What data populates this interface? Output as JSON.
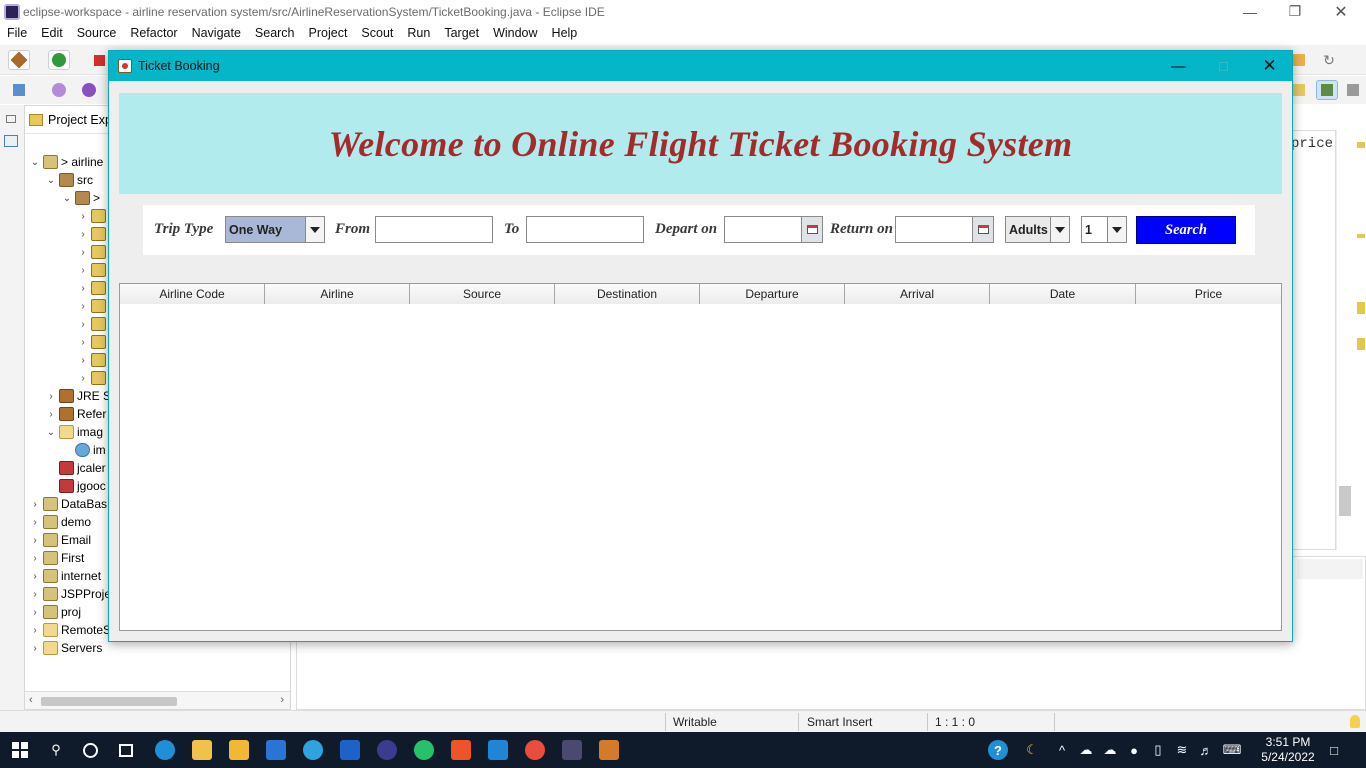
{
  "eclipse": {
    "title": "eclipse-workspace - airline reservation system/src/AirlineReservationSystem/TicketBooking.java - Eclipse IDE",
    "menu": [
      "File",
      "Edit",
      "Source",
      "Refactor",
      "Navigate",
      "Search",
      "Project",
      "Scout",
      "Run",
      "Target",
      "Window",
      "Help"
    ],
    "explorer_title": "Project Exp",
    "editor_fragment": "price",
    "tree": [
      {
        "label": "> airline",
        "icon": "project-icon",
        "twisty": "v"
      },
      {
        "label": "src",
        "icon": "package-folder-icon",
        "twisty": "v"
      },
      {
        "label": ">",
        "icon": "package-icon",
        "twisty": "v"
      },
      {
        "label": "",
        "icon": "java-file-icon",
        "twisty": ">"
      },
      {
        "label": "",
        "icon": "java-file-icon",
        "twisty": ">"
      },
      {
        "label": "",
        "icon": "java-file-icon",
        "twisty": ">"
      },
      {
        "label": "",
        "icon": "java-file-icon",
        "twisty": ">"
      },
      {
        "label": "",
        "icon": "java-file-icon",
        "twisty": ">"
      },
      {
        "label": "",
        "icon": "java-file-icon",
        "twisty": ">"
      },
      {
        "label": "",
        "icon": "java-file-icon",
        "twisty": ">"
      },
      {
        "label": "",
        "icon": "java-file-icon",
        "twisty": ">"
      },
      {
        "label": "",
        "icon": "java-file-icon",
        "twisty": ">"
      },
      {
        "label": "",
        "icon": "java-file-icon",
        "twisty": ">"
      },
      {
        "label": "JRE S",
        "icon": "library-icon",
        "twisty": ">"
      },
      {
        "label": "Refer",
        "icon": "library-icon",
        "twisty": ">"
      },
      {
        "label": "imag",
        "icon": "folder-icon",
        "twisty": "v"
      },
      {
        "label": "im",
        "icon": "image-icon",
        "twisty": ""
      },
      {
        "label": "jcaler",
        "icon": "jar-icon",
        "twisty": ""
      },
      {
        "label": "jgooc",
        "icon": "jar-icon",
        "twisty": ""
      },
      {
        "label": "DataBas",
        "icon": "project-icon",
        "twisty": ">"
      },
      {
        "label": "demo",
        "icon": "project-icon",
        "twisty": ">"
      },
      {
        "label": "Email",
        "icon": "project-icon",
        "twisty": ">"
      },
      {
        "label": "First",
        "icon": "project-icon",
        "twisty": ">"
      },
      {
        "label": "internet",
        "icon": "project-icon",
        "twisty": ">"
      },
      {
        "label": "JSPProje",
        "icon": "project-icon",
        "twisty": ">"
      },
      {
        "label": "proj",
        "icon": "project-icon",
        "twisty": ">"
      },
      {
        "label": "RemoteSystemsTempFiles",
        "icon": "folder-icon",
        "twisty": ">"
      },
      {
        "label": "Servers",
        "icon": "folder-icon",
        "twisty": ">"
      }
    ],
    "status": {
      "writable": "Writable",
      "insert_mode": "Smart Insert",
      "position": "1 : 1 : 0"
    }
  },
  "dialog": {
    "title": "Ticket Booking",
    "banner": "Welcome to Online Flight Ticket Booking System",
    "form": {
      "trip_type_label": "Trip Type",
      "trip_type_value": "One Way",
      "from_label": "From",
      "from_value": "",
      "to_label": "To",
      "to_value": "",
      "depart_label": "Depart on",
      "depart_value": "",
      "return_label": "Return on",
      "return_value": "",
      "passenger_type": "Adults",
      "passenger_count": "1",
      "search_label": "Search"
    },
    "table": {
      "columns": [
        "Airline Code",
        "Airline",
        "Source",
        "Destination",
        "Departure",
        "Arrival",
        "Date",
        "Price"
      ],
      "rows": []
    }
  },
  "taskbar": {
    "time": "3:51 PM",
    "date": "5/24/2022"
  },
  "colors": {
    "dialog_title_bar": "#04b6c8",
    "banner_bg": "#b2ebee",
    "banner_text": "#a52a2a",
    "search_button": "#0000ff"
  }
}
